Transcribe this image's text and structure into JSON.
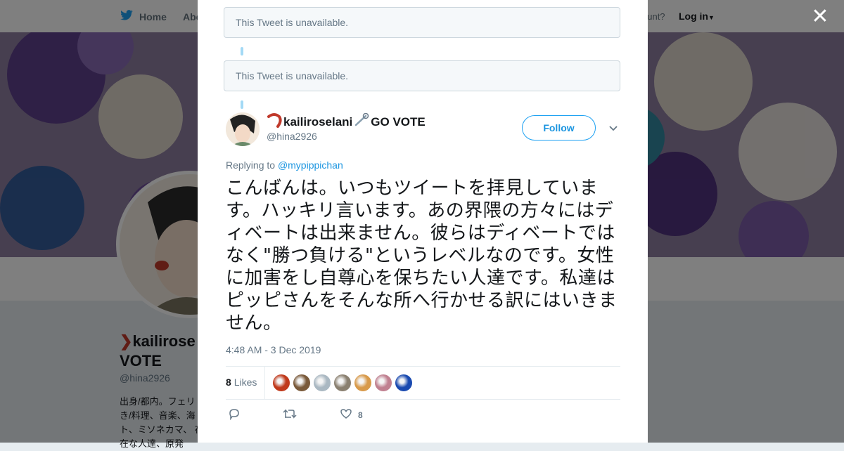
{
  "topbar": {
    "home_label": "Home",
    "about_label": "Abo",
    "account_text": "ccount?",
    "login_label": "Log in"
  },
  "background_profile": {
    "name_line1": "kailirose",
    "name_line2": "VOTE",
    "handle": "@hina2926",
    "bio": "出身/都内。フェリ き/料理、音楽、海 ト、ミソネカマ、 存在な人達、原発"
  },
  "modal": {
    "unavailable_1": "This Tweet is unavailable.",
    "unavailable_2": "This Tweet is unavailable.",
    "tweet": {
      "display_name": "kailiroselani",
      "display_suffix": "GO VOTE",
      "handle": "@hina2926",
      "follow_label": "Follow",
      "replying_prefix": "Replying to",
      "replying_to": "@mypippichan",
      "text": "こんばんは。いつもツイートを拝見しています。ハッキリ言います。あの界隈の方々にはディベートは出来ません。彼らはディベートではなく\"勝つ負ける\"というレベルなのです。女性に加害をし自尊心を保ちたい人達です。私達はピッピさんをそんな所へ行かせる訳にはいきません。",
      "timestamp": "4:48 AM - 3 Dec 2019",
      "likes_count": "8",
      "likes_label": "Likes",
      "like_action_count": "8",
      "likers": [
        {
          "color": "#c0391b"
        },
        {
          "color": "#7a5a3a"
        },
        {
          "color": "#aab8c2"
        },
        {
          "color": "#8a8070"
        },
        {
          "color": "#d89a4a"
        },
        {
          "color": "#c08090"
        },
        {
          "color": "#1a4ab0"
        }
      ]
    }
  },
  "colors": {
    "accent": "#1da1f2",
    "link": "#1b95e0",
    "text": "#14171a",
    "muted": "#657786"
  }
}
